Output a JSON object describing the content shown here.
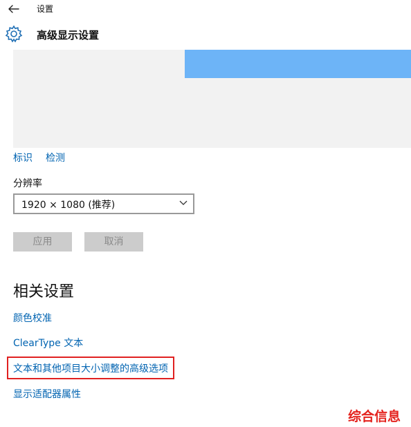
{
  "window": {
    "title": "设置"
  },
  "header": {
    "title": "高级显示设置"
  },
  "display": {
    "identify_label": "标识",
    "detect_label": "检测",
    "resolution_label": "分辨率",
    "resolution_value": "1920 × 1080 (推荐)"
  },
  "buttons": {
    "apply_label": "应用",
    "cancel_label": "取消"
  },
  "related": {
    "title": "相关设置",
    "links": [
      "颜色校准",
      "ClearType 文本",
      "文本和其他项目大小调整的高级选项",
      "显示适配器属性"
    ]
  },
  "watermark": {
    "text": "综合信息"
  },
  "colors": {
    "link": "#0063b1",
    "monitor": "#6db4f7",
    "highlight_border": "#e02020",
    "watermark": "#e4231e"
  },
  "icons": {
    "back": "back-arrow-icon",
    "settings": "gear-icon",
    "dropdown": "chevron-down-icon"
  }
}
